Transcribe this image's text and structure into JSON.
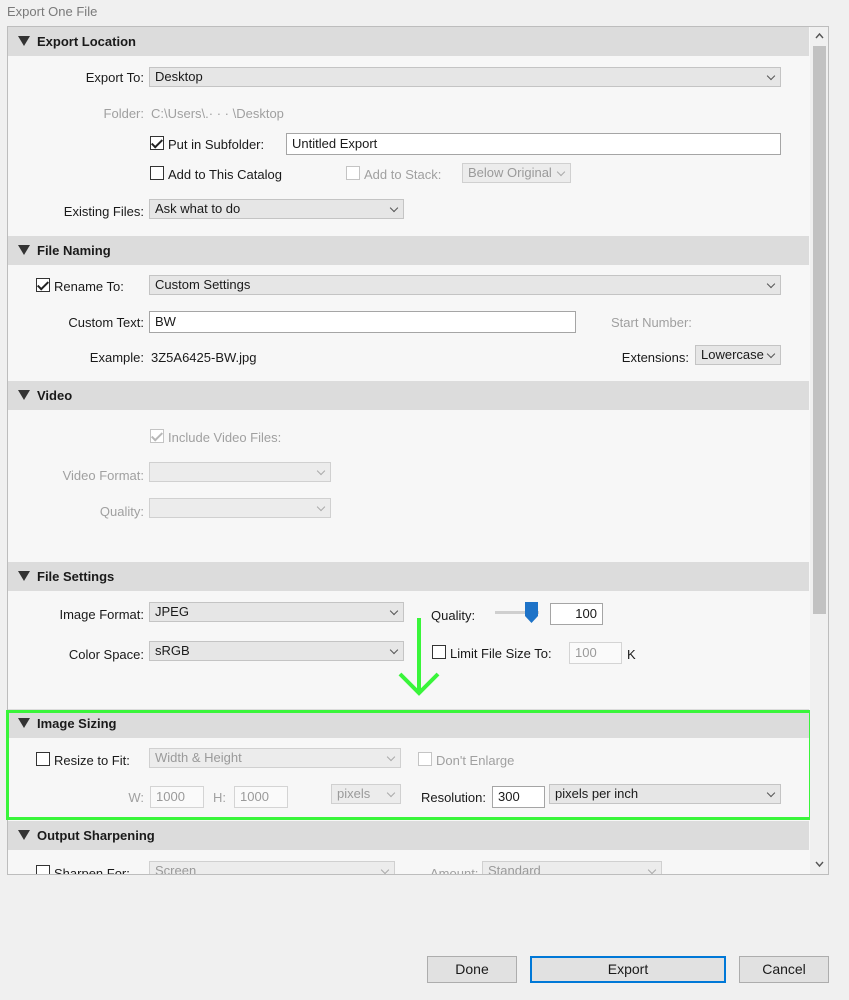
{
  "window": {
    "title": "Export One File"
  },
  "export_location": {
    "header": "Export Location",
    "export_to_label": "Export To:",
    "export_to_value": "Desktop",
    "folder_label": "Folder:",
    "folder_value": "C:\\Users\\.· · · \\Desktop",
    "put_in_subfolder_label": "Put in Subfolder:",
    "subfolder_value": "Untitled Export",
    "add_to_catalog_label": "Add to This Catalog",
    "add_to_stack_label": "Add to Stack:",
    "stack_position": "Below Original",
    "existing_files_label": "Existing Files:",
    "existing_files_value": "Ask what to do"
  },
  "file_naming": {
    "header": "File Naming",
    "rename_to_label": "Rename To:",
    "rename_to_value": "Custom Settings",
    "custom_text_label": "Custom Text:",
    "custom_text_value": "BW",
    "start_number_label": "Start Number:",
    "example_label": "Example:",
    "example_value": "3Z5A6425-BW.jpg",
    "extensions_label": "Extensions:",
    "extensions_value": "Lowercase"
  },
  "video": {
    "header": "Video",
    "include_video_label": "Include Video Files:",
    "video_format_label": "Video Format:",
    "quality_label": "Quality:"
  },
  "file_settings": {
    "header": "File Settings",
    "image_format_label": "Image Format:",
    "image_format_value": "JPEG",
    "quality_label": "Quality:",
    "quality_value": "100",
    "color_space_label": "Color Space:",
    "color_space_value": "sRGB",
    "limit_file_size_label": "Limit File Size To:",
    "limit_file_size_value": "100",
    "limit_unit": "K"
  },
  "image_sizing": {
    "header": "Image Sizing",
    "resize_to_fit_label": "Resize to Fit:",
    "resize_mode": "Width & Height",
    "dont_enlarge_label": "Don't Enlarge",
    "w_label": "W:",
    "w_value": "1000",
    "h_label": "H:",
    "h_value": "1000",
    "unit": "pixels",
    "resolution_label": "Resolution:",
    "resolution_value": "300",
    "resolution_unit": "pixels per inch"
  },
  "output_sharpening": {
    "header": "Output Sharpening",
    "sharpen_for_label": "Sharpen For:",
    "sharpen_for_value": "Screen",
    "amount_label": "Amount:",
    "amount_value": "Standard"
  },
  "buttons": {
    "done": "Done",
    "export": "Export",
    "cancel": "Cancel"
  },
  "colors": {
    "highlight": "#39f53a",
    "arrow": "#39f53a",
    "slider_thumb": "#1e73c8",
    "default_button_border": "#0078d7"
  },
  "icons": {
    "section_toggle": "triangle-down-icon",
    "annotation_arrow": "arrow-down-icon"
  }
}
